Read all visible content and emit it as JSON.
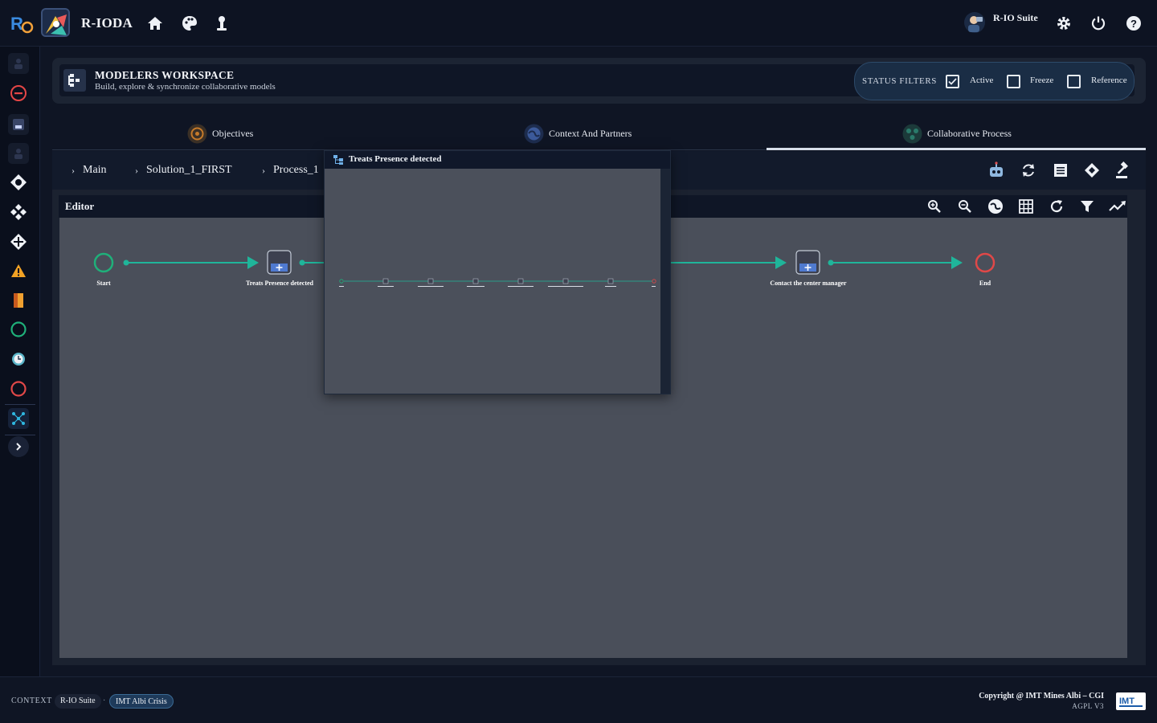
{
  "app": {
    "title": "R-IODA",
    "user_name": "R-IO Suite"
  },
  "topbar": {
    "icons": [
      "home-icon",
      "palette-icon",
      "person-pin-icon"
    ],
    "right_icons": [
      "settings-icon",
      "power-icon",
      "help-icon"
    ]
  },
  "rail": {
    "items": [
      "warning-user-icon",
      "minus-circle-icon",
      "user-box-icon",
      "person-icon",
      "target-icon",
      "diamond-cluster-icon",
      "cross-arrows-icon",
      "alert-icon",
      "document-icon",
      "circle-green-icon",
      "clock-icon",
      "circle-red-icon",
      "network-icon",
      "expand-chevron-icon"
    ]
  },
  "workspace": {
    "title": "MODELERS WORKSPACE",
    "subtitle": "Build, explore & synchronize collaborative models",
    "filters_label": "STATUS FILTERS",
    "filters": [
      {
        "label": "Active",
        "checked": true
      },
      {
        "label": "Freeze",
        "checked": false
      },
      {
        "label": "Reference",
        "checked": false
      }
    ]
  },
  "tabs": [
    {
      "label": "Objectives",
      "active": false
    },
    {
      "label": "Context And Partners",
      "active": false
    },
    {
      "label": "Collaborative Process",
      "active": true
    }
  ],
  "breadcrumb": [
    "Main",
    "Solution_1_FIRST",
    "Process_1"
  ],
  "toolbar": {
    "icons": [
      "robot-icon",
      "sync-icon",
      "list-icon",
      "diamond-icon",
      "gavel-icon"
    ]
  },
  "editor": {
    "title": "Editor",
    "tools": [
      "zoom-in-icon",
      "zoom-out-icon",
      "globe-icon",
      "grid-icon",
      "refresh-icon",
      "filter-icon",
      "trend-icon"
    ],
    "nodes": {
      "start": "Start",
      "task1": "Treats Presence detected",
      "task2": "Contact the center manager",
      "end": "End"
    }
  },
  "popup": {
    "title": "Treats Presence detected"
  },
  "footer": {
    "context_label": "CONTEXT",
    "chips": [
      "R-IO Suite",
      "IMT Albi Crisis"
    ],
    "copyright": "Copyright @ IMT Mines Albi – CGI",
    "license": "AGPL V3"
  },
  "colors": {
    "flow": "#1fb59a",
    "start": "#22b07d",
    "end": "#e04848",
    "active_chip": "#1e3a5a"
  }
}
